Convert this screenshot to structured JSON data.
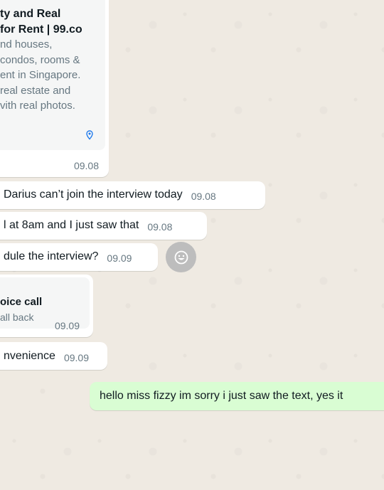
{
  "link_preview": {
    "title_lines": [
      "ty and Real",
      "for Rent | 99.co"
    ],
    "desc_lines": [
      "nd houses,",
      " condos, rooms &",
      "ent in Singapore.",
      "real estate and",
      "vith real photos."
    ],
    "time": "09.08"
  },
  "messages": [
    {
      "text": "Darius can’t join the interview today",
      "time": "09.08"
    },
    {
      "text": "l at 8am and I just saw that",
      "time": "09.08"
    },
    {
      "text": "dule the interview?",
      "time": "09.09"
    },
    {
      "text": "nvenience",
      "time": "09.09"
    }
  ],
  "voice_call": {
    "title": "oice call",
    "subtitle": "all back",
    "time": "09.09"
  },
  "outgoing_message": {
    "text": "hello miss fizzy im sorry i just saw the text, yes it"
  },
  "icons": {
    "location_pin": "location-pin-icon",
    "emoji_reaction": "smiley-icon"
  }
}
